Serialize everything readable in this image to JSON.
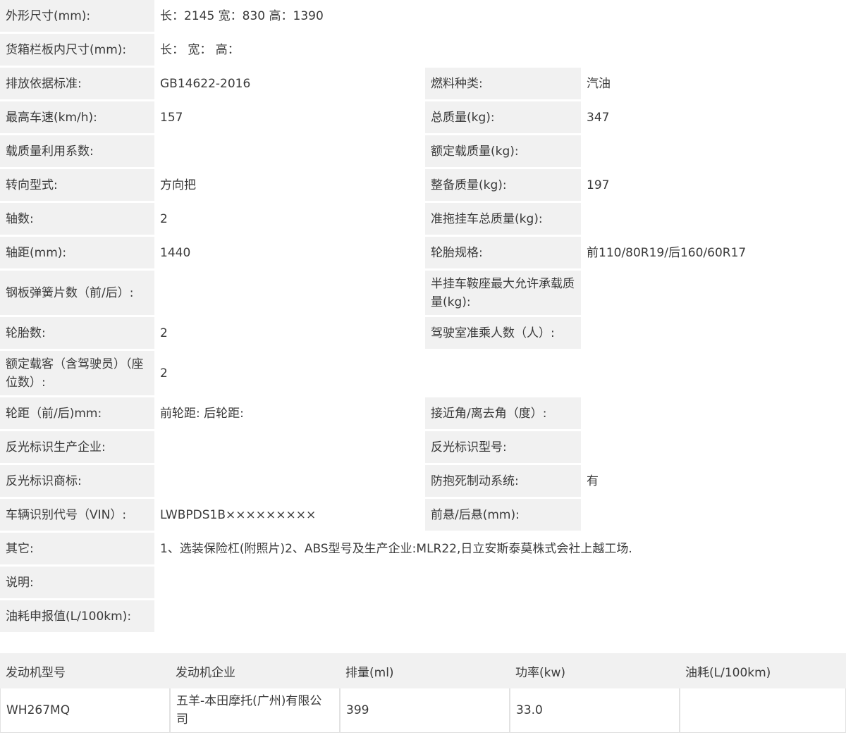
{
  "specs": {
    "dimensions_label": "外形尺寸(mm):",
    "dimensions_value": "长：2145 宽：830 高：1390",
    "cargo_dims_label": "货箱栏板内尺寸(mm):",
    "cargo_dims_value": "长： 宽： 高：",
    "emission_std_label": "排放依据标准:",
    "emission_std_value": "GB14622-2016",
    "fuel_type_label": "燃料种类:",
    "fuel_type_value": "汽油",
    "max_speed_label": "最高车速(km/h):",
    "max_speed_value": "157",
    "total_mass_label": "总质量(kg):",
    "total_mass_value": "347",
    "load_util_label": "载质量利用系数:",
    "load_util_value": "",
    "rated_load_label": "额定载质量(kg):",
    "rated_load_value": "",
    "steering_label": "转向型式:",
    "steering_value": "方向把",
    "curb_mass_label": "整备质量(kg):",
    "curb_mass_value": "197",
    "axles_label": "轴数:",
    "axles_value": "2",
    "trailer_mass_label": "准拖挂车总质量(kg):",
    "trailer_mass_value": "",
    "wheelbase_label": "轴距(mm):",
    "wheelbase_value": "1440",
    "tire_spec_label": "轮胎规格:",
    "tire_spec_value": "前110/80R19/后160/60R17",
    "leaf_spring_label": "钢板弹簧片数（前/后）:",
    "leaf_spring_value": "",
    "saddle_load_label": "半挂车鞍座最大允许承载质量(kg):",
    "saddle_load_value": "",
    "tire_count_label": "轮胎数:",
    "tire_count_value": "2",
    "cab_seats_label": "驾驶室准乘人数（人）:",
    "cab_seats_value": "",
    "passengers_label": "额定载客（含驾驶员）（座位数）:",
    "passengers_value": "2",
    "track_label": "轮距（前/后)mm:",
    "track_value": "前轮距: 后轮距:",
    "angles_label": "接近角/离去角（度）:",
    "angles_value": "",
    "reflector_maker_label": "反光标识生产企业:",
    "reflector_maker_value": "",
    "reflector_model_label": "反光标识型号:",
    "reflector_model_value": "",
    "reflector_brand_label": "反光标识商标:",
    "reflector_brand_value": "",
    "abs_label": "防抱死制动系统:",
    "abs_value": "有",
    "vin_label": "车辆识别代号（VIN）:",
    "vin_value": "LWBPDS1B×××××××××",
    "overhang_label": "前悬/后悬(mm):",
    "overhang_value": "",
    "other_label": "其它:",
    "other_value": "1、选装保险杠(附照片)2、ABS型号及生产企业:MLR22,日立安斯泰莫株式会社上越工场.",
    "notes_label": "说明:",
    "notes_value": "",
    "fuel_decl_label": "油耗申报值(L/100km):",
    "fuel_decl_value": ""
  },
  "engine": {
    "headers": {
      "model": "发动机型号",
      "maker": "发动机企业",
      "displacement": "排量(ml)",
      "power": "功率(kw)",
      "consumption": "油耗(L/100km)"
    },
    "row": {
      "model": "WH267MQ",
      "maker": "五羊-本田摩托(广州)有限公司",
      "displacement": "399",
      "power": "33.0",
      "consumption": ""
    }
  }
}
